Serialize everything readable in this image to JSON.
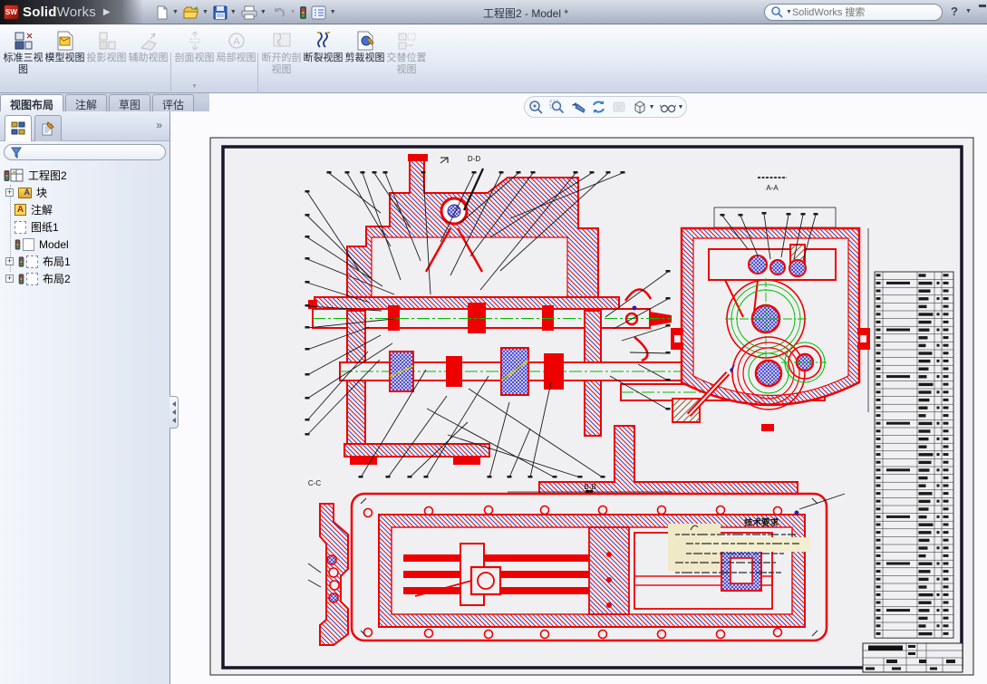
{
  "titlebar": {
    "app_bold": "Solid",
    "app_light": "Works",
    "document_title": "工程图2 - Model *",
    "search_placeholder": "SolidWorks 搜索",
    "help_label": "?"
  },
  "quick_access": {
    "buttons": [
      {
        "icon": "new-document-icon",
        "dropdown": true
      },
      {
        "icon": "open-icon",
        "dropdown": true
      },
      {
        "icon": "save-icon",
        "dropdown": true
      },
      {
        "icon": "print-icon",
        "dropdown": true
      },
      {
        "icon": "undo-icon",
        "dropdown": true,
        "disabled": true
      },
      {
        "icon": "rebuild-traffic-light-icon",
        "dropdown": false
      },
      {
        "icon": "options-list-icon",
        "dropdown": true
      }
    ]
  },
  "command_manager": {
    "buttons": [
      {
        "label": "标准三视图",
        "enabled": true
      },
      {
        "label": "模型视图",
        "enabled": true
      },
      {
        "label": "投影视图",
        "enabled": false
      },
      {
        "label": "辅助视图",
        "enabled": false
      },
      {
        "label": "剖面视图",
        "enabled": false,
        "dropdown": true
      },
      {
        "label": "局部视图",
        "enabled": false
      },
      {
        "label": "断开的剖视图",
        "enabled": false
      },
      {
        "label": "断裂视图",
        "enabled": true
      },
      {
        "label": "剪裁视图",
        "enabled": true
      },
      {
        "label": "交替位置视图",
        "enabled": false
      }
    ]
  },
  "ribbon_tabs": {
    "items": [
      {
        "label": "视图布局",
        "active": true
      },
      {
        "label": "注解",
        "active": false
      },
      {
        "label": "草图",
        "active": false
      },
      {
        "label": "评估",
        "active": false
      }
    ],
    "panel_expand_chevron": "»"
  },
  "feature_tree": {
    "items": [
      {
        "label": "工程图2",
        "icon": "drawing-doc-icon",
        "expander": ""
      },
      {
        "label": "块",
        "icon": "blocks-folder-icon",
        "expander": "+"
      },
      {
        "label": "注解",
        "icon": "annotations-icon",
        "expander": ""
      },
      {
        "label": "图纸1",
        "icon": "sheet-icon",
        "expander": ""
      },
      {
        "label": "Model",
        "icon": "model-sheet-icon",
        "expander": ""
      },
      {
        "label": "布局1",
        "icon": "layout-sheet-icon",
        "expander": "+"
      },
      {
        "label": "布局2",
        "icon": "layout-sheet-icon",
        "expander": "+"
      }
    ]
  },
  "headsup_toolbar": {
    "buttons": [
      {
        "icon": "zoom-to-fit-icon"
      },
      {
        "icon": "zoom-to-area-icon"
      },
      {
        "icon": "previous-view-icon"
      },
      {
        "icon": "redraw-icon"
      },
      {
        "icon": "view-orientation-icon",
        "disabled": true
      },
      {
        "icon": "display-style-icon",
        "dropdown": true
      },
      {
        "icon": "hide-show-items-icon",
        "dropdown": true
      }
    ]
  },
  "drawing": {
    "labels": {
      "dd": "D-D",
      "aa": "A-A",
      "bb": "B-B",
      "cc": "C-C",
      "tech": "技术要求"
    },
    "colors": {
      "drawing_red": "#ee0000",
      "hatch_blue": "#3b3bc8",
      "centerline_green": "#00bb00",
      "leader_black": "#1a1a1a",
      "sheet_bg": "#f0f0f3",
      "highlight_cream": "#efe9c8"
    },
    "bom": {
      "rows": 47,
      "columns": 5
    }
  }
}
